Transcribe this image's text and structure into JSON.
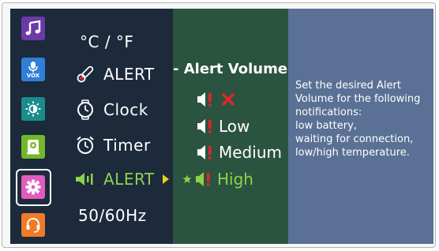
{
  "colors": {
    "background": "#1c2a3c",
    "submenu_background": "#2b5440",
    "description_background": "#5a7195",
    "accent_green": "#8ed14c",
    "alert_red": "#e5232b",
    "arrow_yellow": "#e8d213"
  },
  "sidebar": {
    "icons": [
      {
        "name": "music-note-icon",
        "color": "#6b3aa6"
      },
      {
        "name": "microphone-vox-icon",
        "color": "#2f7fd6",
        "label": "VOX"
      },
      {
        "name": "brightness-icon",
        "color": "#1a8c8c"
      },
      {
        "name": "camera-icon",
        "color": "#72b829"
      },
      {
        "name": "settings-gear-icon",
        "color": "#e05dbd",
        "selected": true
      },
      {
        "name": "headset-icon",
        "color": "#ef7a27"
      }
    ]
  },
  "menu": {
    "items": [
      {
        "label": "°C / °F",
        "icon": "none"
      },
      {
        "label": "ALERT",
        "icon": "thermometer-icon"
      },
      {
        "label": "Clock",
        "icon": "clock-icon"
      },
      {
        "label": "Timer",
        "icon": "timer-icon"
      },
      {
        "label": "ALERT",
        "icon": "speaker-volume-icon",
        "active": true
      },
      {
        "label": "50/60Hz",
        "icon": "none"
      }
    ]
  },
  "submenu": {
    "title": "- Alert Volume-",
    "items": [
      {
        "label": "",
        "icon": "speaker-alert-icon",
        "status": "off-x-icon"
      },
      {
        "label": "Low",
        "icon": "speaker-alert-icon"
      },
      {
        "label": "Medium",
        "icon": "speaker-alert-icon"
      },
      {
        "label": "High",
        "icon": "speaker-alert-icon",
        "selected": true,
        "marker": "star-icon"
      }
    ]
  },
  "description": {
    "lines": [
      "Set the desired Alert",
      "Volume for the following",
      "notifications:",
      "low battery,",
      "waiting for connection,",
      "low/high temperature."
    ]
  }
}
